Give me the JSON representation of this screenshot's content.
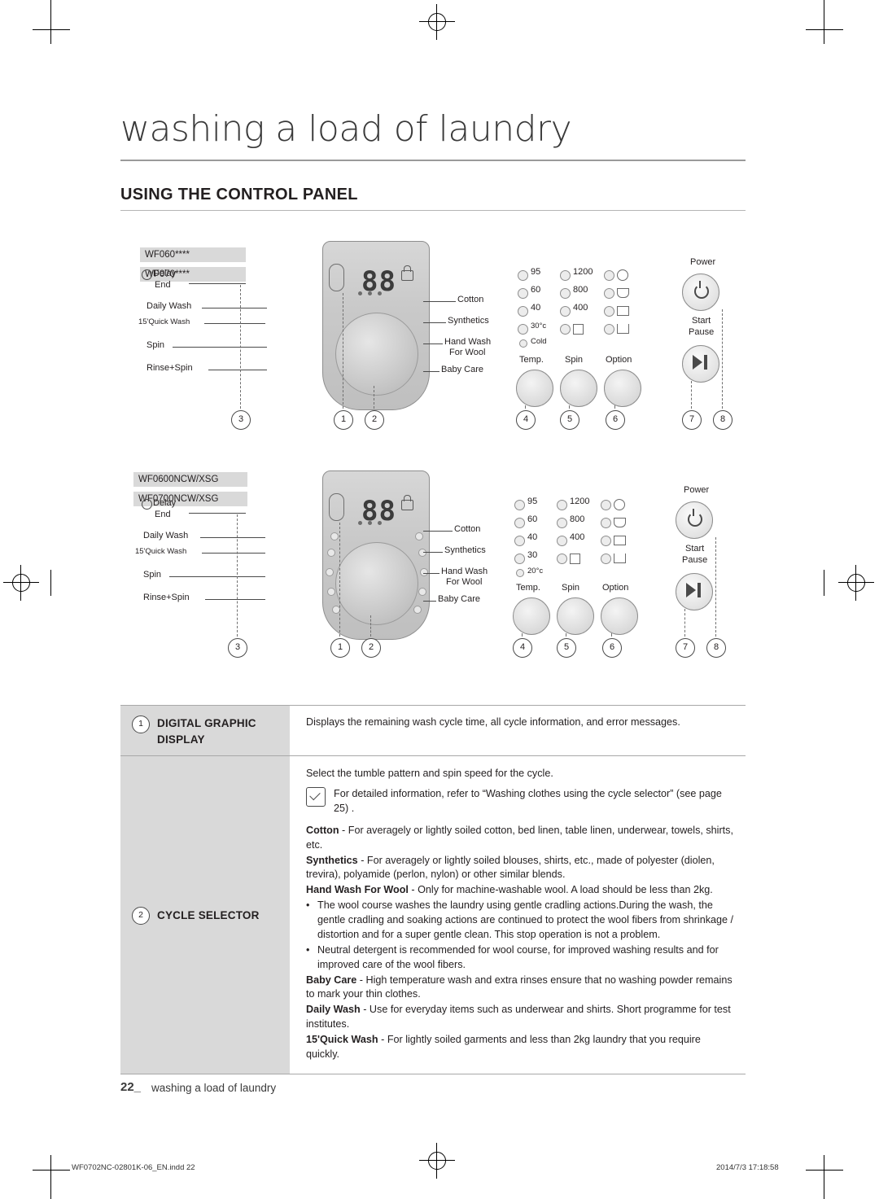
{
  "page": {
    "chapter_title": "washing a load of laundry",
    "section_title": "USING THE CONTROL PANEL",
    "footer_page_number": "22_",
    "footer_text": "washing a load of laundry",
    "print_filename": "WF0702NC-02801K-06_EN.indd   22",
    "print_timestamp": "2014/7/3   17:18:58"
  },
  "diagram_top": {
    "model_line1": "WF060****",
    "model_line2": "WF070****",
    "lcd": "88",
    "left_labels": [
      "Delay",
      "End",
      "Daily Wash",
      "15'Quick Wash",
      "Spin",
      "Rinse+Spin"
    ],
    "right_labels": [
      "Cotton",
      "Synthetics",
      "Hand Wash",
      "For Wool",
      "Baby Care"
    ],
    "temp_values": [
      "95",
      "60",
      "40",
      "30°c",
      "Cold"
    ],
    "spin_values": [
      "1200",
      "800",
      "400"
    ],
    "group_labels": [
      "Temp.",
      "Spin",
      "Option"
    ],
    "power_label": "Power",
    "start_label": "Start",
    "pause_label": "Pause",
    "callouts": [
      "3",
      "1",
      "2",
      "4",
      "5",
      "6",
      "7",
      "8"
    ]
  },
  "diagram_bottom": {
    "model_line1": "WF0600NCW/XSG",
    "model_line2": "WF0700NCW/XSG",
    "lcd": "88",
    "left_labels": [
      "Delay",
      "End",
      "Daily Wash",
      "15'Quick Wash",
      "Spin",
      "Rinse+Spin"
    ],
    "right_labels": [
      "Cotton",
      "Synthetics",
      "Hand Wash",
      "For Wool",
      "Baby Care"
    ],
    "temp_values": [
      "95",
      "60",
      "40",
      "30",
      "20°c"
    ],
    "spin_values": [
      "1200",
      "800",
      "400"
    ],
    "group_labels": [
      "Temp.",
      "Spin",
      "Option"
    ],
    "power_label": "Power",
    "start_label": "Start",
    "pause_label": "Pause",
    "callouts": [
      "3",
      "1",
      "2",
      "4",
      "5",
      "6",
      "7",
      "8"
    ]
  },
  "table": {
    "row1": {
      "num": "1",
      "label_line1": "DIGITAL GRAPHIC",
      "label_line2": "DISPLAY",
      "text": "Displays the remaining wash cycle time, all cycle information, and error messages."
    },
    "row2": {
      "num": "2",
      "label": "CYCLE SELECTOR",
      "intro": "Select the tumble pattern and spin speed for the cycle.",
      "note": "For detailed information, refer to “Washing clothes using the cycle selector” (see page 25) .",
      "items": [
        {
          "term": "Cotton",
          "desc": " - For averagely or lightly soiled cotton, bed linen, table linen, underwear, towels, shirts, etc."
        },
        {
          "term": "Synthetics",
          "desc": " - For averagely or lightly soiled blouses, shirts, etc., made of polyester (diolen, trevira), polyamide (perlon, nylon) or other similar blends."
        },
        {
          "term": "Hand Wash For Wool",
          "desc": " - Only for machine-washable wool. A load should be less than 2kg."
        }
      ],
      "bullets": [
        "The wool course washes the laundry using gentle cradling actions.During the wash, the gentle cradling and soaking actions are continued to protect the wool fibers from shrinkage / distortion and for a super gentle clean. This stop operation is not a problem.",
        "Neutral detergent is recommended for wool course, for improved washing results and for improved care of the wool fibers."
      ],
      "items2": [
        {
          "term": "Baby Care",
          "desc": " - High temperature wash and extra rinses ensure that no washing powder remains to mark your thin clothes."
        },
        {
          "term": "Daily Wash",
          "desc": " - Use for everyday items such as underwear and shirts. Short programme for test institutes."
        },
        {
          "term": "15'Quick Wash",
          "desc": " - For lightly soiled garments and less than 2kg laundry that you require quickly."
        }
      ]
    }
  }
}
